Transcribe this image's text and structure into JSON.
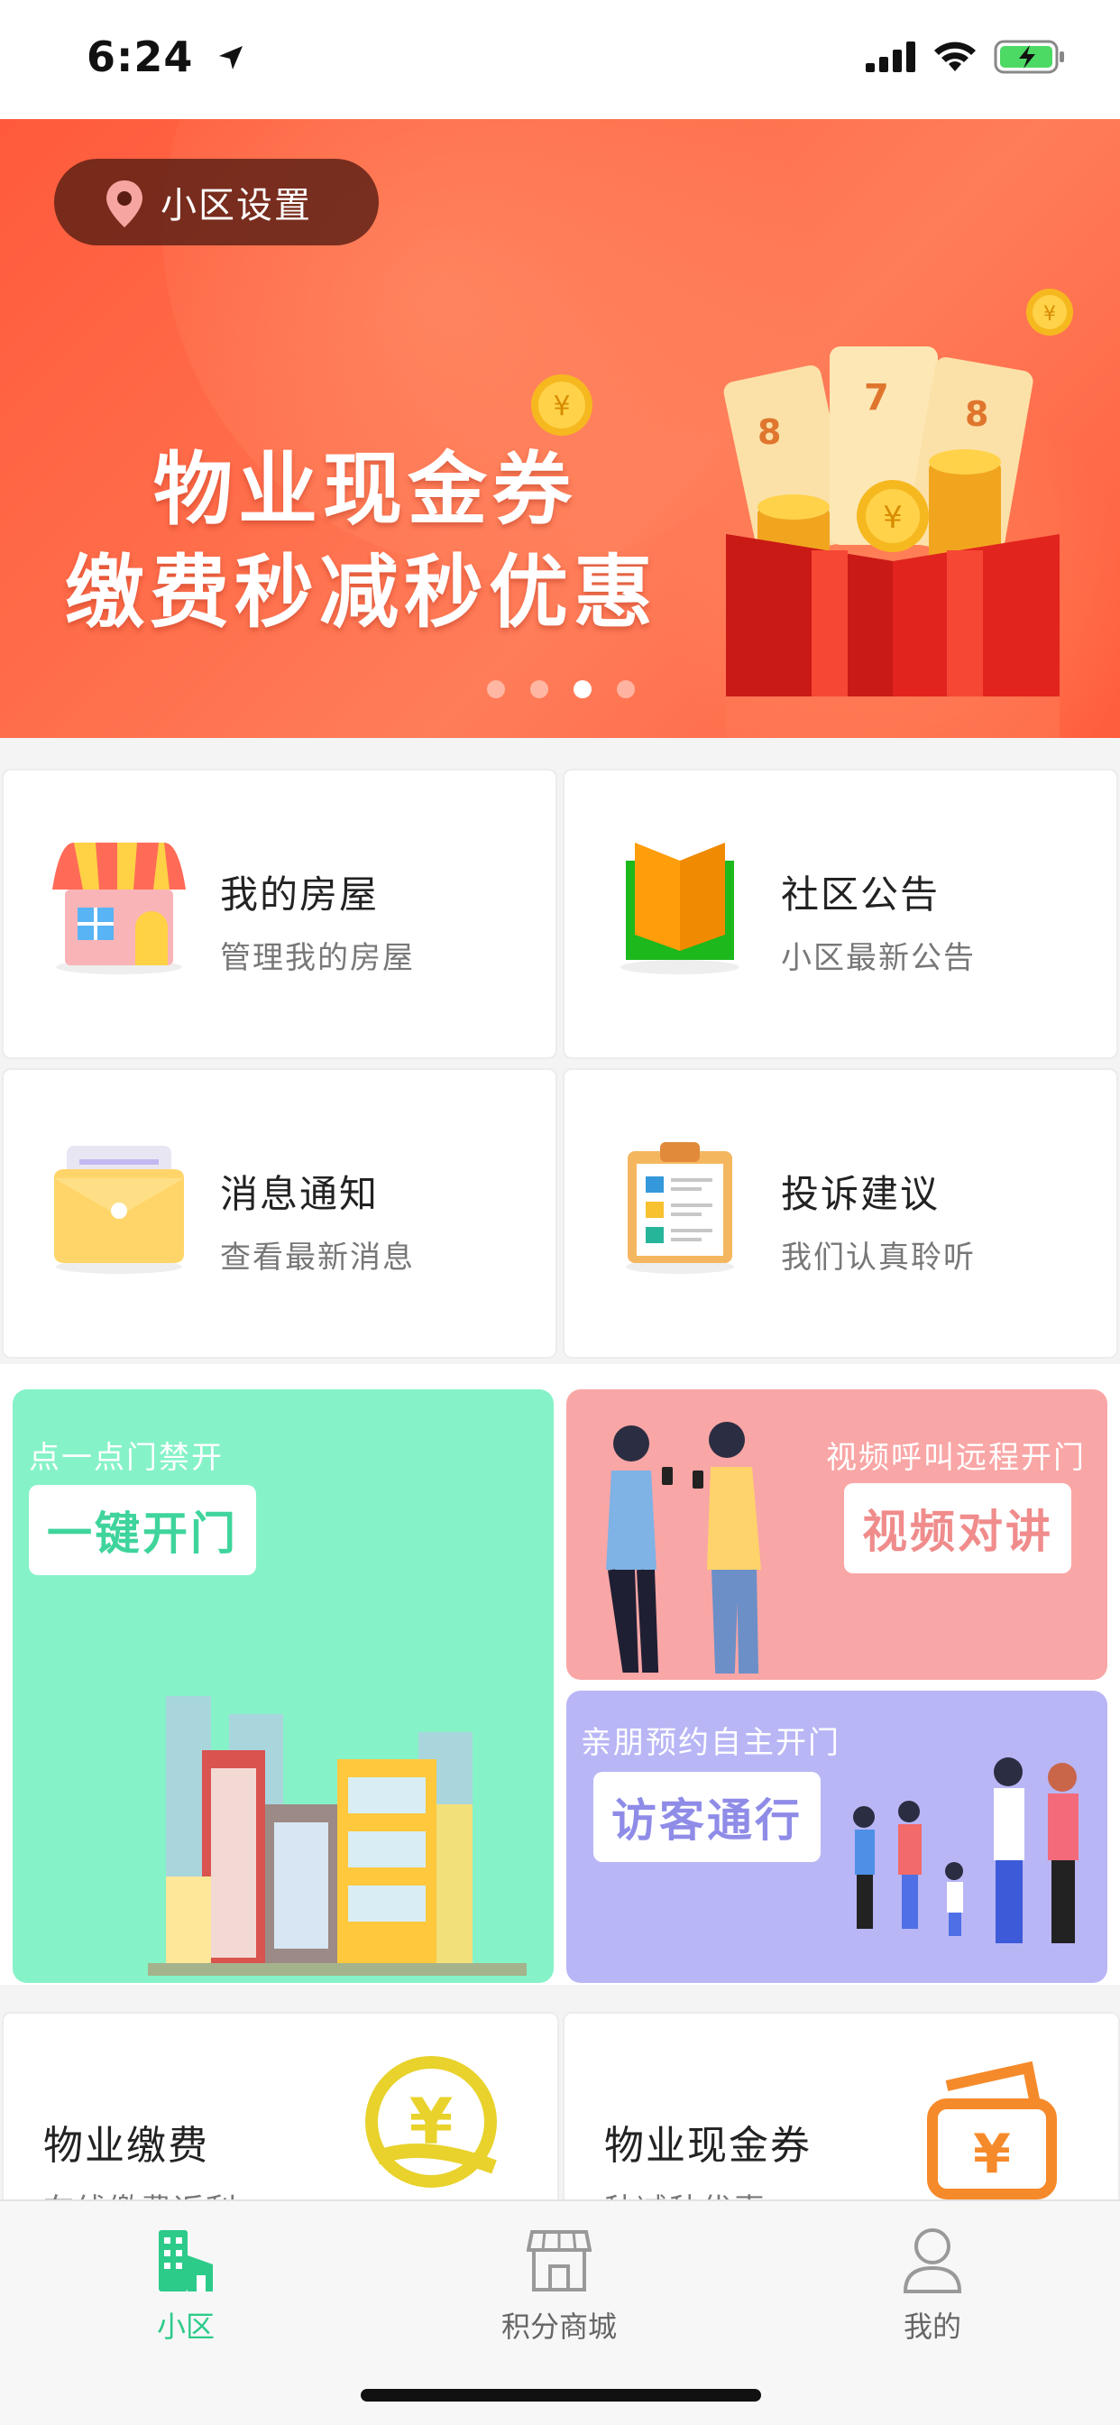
{
  "status_bar": {
    "time": "6:24"
  },
  "banner": {
    "location_label": "小区设置",
    "title": "物业现金券",
    "subtitle": "缴费秒减秒优惠",
    "dots_count": 4,
    "active_dot": 3,
    "colors": {
      "primary": "#ff5a3c",
      "chip": "#5a1e14"
    }
  },
  "features": [
    {
      "title": "我的房屋",
      "subtitle": "管理我的房屋",
      "icon": "house-icon"
    },
    {
      "title": "社区公告",
      "subtitle": "小区最新公告",
      "icon": "book-icon"
    },
    {
      "title": "消息通知",
      "subtitle": "查看最新消息",
      "icon": "envelope-icon"
    },
    {
      "title": "投诉建议",
      "subtitle": "我们认真聆听",
      "icon": "clipboard-icon"
    }
  ],
  "tiles": {
    "open_door": {
      "subtitle": "点一点门禁开",
      "button": "一键开门",
      "color": "#86f2c8"
    },
    "video_call": {
      "subtitle": "视频呼叫远程开门",
      "button": "视频对讲",
      "color": "#f9a6a6"
    },
    "visitor": {
      "subtitle": "亲朋预约自主开门",
      "button": "访客通行",
      "color": "#b9b6f6"
    }
  },
  "lower_cards": [
    {
      "title": "物业缴费",
      "subtitle": "在线缴费返利",
      "icon": "yen-hand-icon"
    },
    {
      "title": "物业现金券",
      "subtitle": "秒减秒优惠",
      "icon": "yen-wallet-icon"
    }
  ],
  "tabbar": {
    "items": [
      {
        "label": "小区",
        "icon": "building-icon",
        "active": true
      },
      {
        "label": "积分商城",
        "icon": "store-icon",
        "active": false
      },
      {
        "label": "我的",
        "icon": "user-icon",
        "active": false
      }
    ],
    "accent": "#2ccb8a"
  }
}
